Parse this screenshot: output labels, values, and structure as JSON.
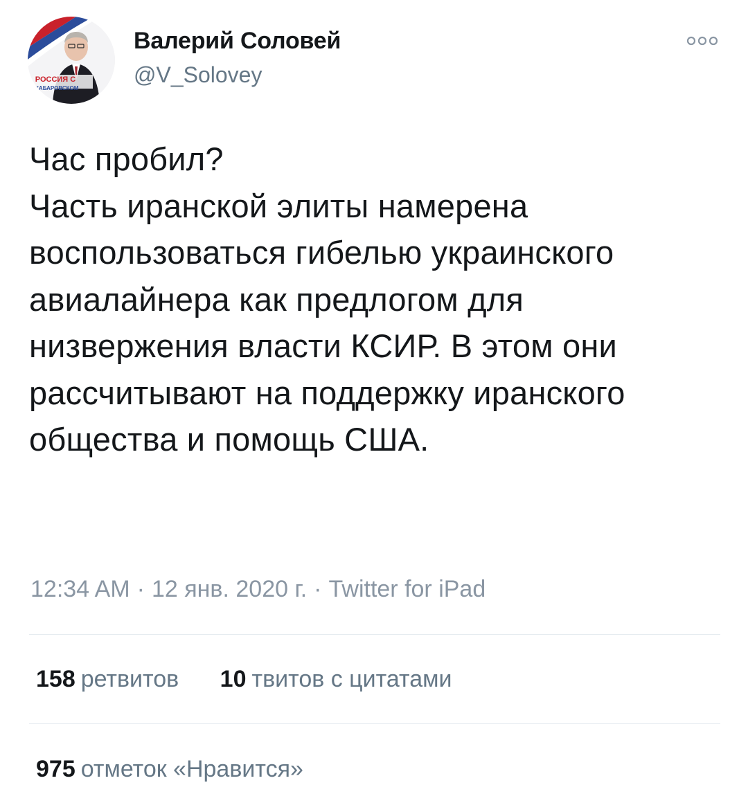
{
  "author": {
    "display_name": "Валерий Соловей",
    "handle": "@V_Solovey",
    "avatar_caption_line1": "РОССИЯ С",
    "avatar_caption_line2": "ХАБАРОВСКОМ"
  },
  "header": {
    "more_icon": "more-horizontal-icon"
  },
  "tweet": {
    "text": "Час пробил?\nЧасть иранской элиты намерена воспользоваться гибелью украинского авиалайнера как предлогом для низвержения власти КСИР. В этом они рассчитывают на поддержку иранского общества и помощь США."
  },
  "meta": {
    "time": "12:34 AM",
    "date": "12 янв. 2020 г.",
    "separator": "·",
    "source": "Twitter for iPad"
  },
  "stats": {
    "retweets": {
      "count": "158",
      "label": "ретвитов"
    },
    "quotes": {
      "count": "10",
      "label": "твитов с цитатами"
    },
    "likes": {
      "count": "975",
      "label": "отметок «Нравится»"
    }
  },
  "colors": {
    "text": "#14171a",
    "secondary": "#657786",
    "meta": "#8a96a3",
    "divider": "#e6ecf0",
    "avatar_red": "#d0202a",
    "avatar_blue": "#2a4fa0"
  }
}
